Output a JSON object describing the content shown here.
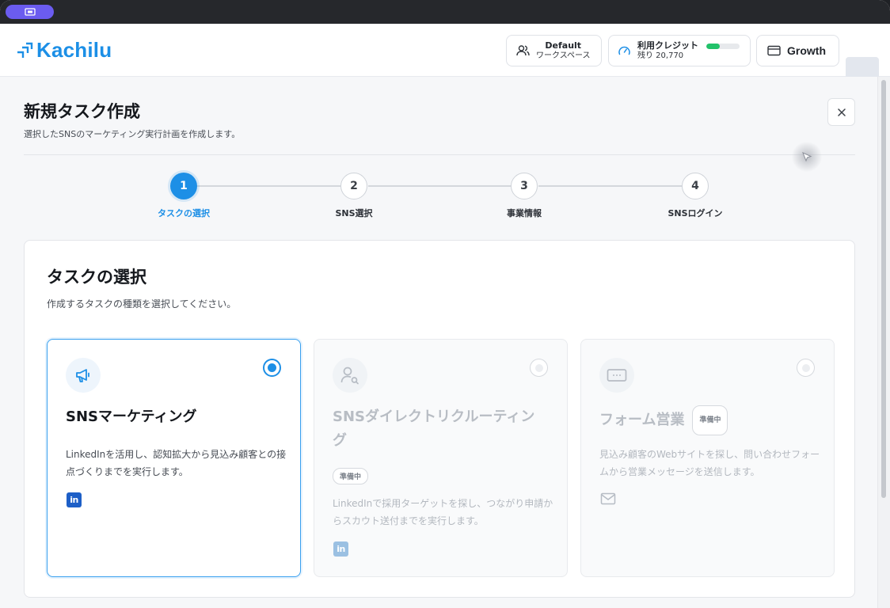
{
  "titlebar": {
    "pill_icon": "screen-share-icon",
    "pill_color": "#6b5cf0"
  },
  "header": {
    "logo_text": "Kachilu",
    "logo_icon": "kachilu-arrow-logo",
    "workspace": {
      "name": "Default",
      "label": "ワークスペース",
      "icon": "users-icon"
    },
    "credits": {
      "label": "利用クレジット",
      "remaining": "残り 20,770",
      "usage_fraction": 0.4,
      "icon": "gauge-icon",
      "bar_color": "#22c26a"
    },
    "plan": {
      "label": "Growth",
      "icon": "credit-card-icon"
    }
  },
  "page": {
    "title": "新規タスク作成",
    "subtitle": "選択したSNSのマーケティング実行計画を作成します。",
    "close_icon": "close-icon"
  },
  "stepper": {
    "active_step": 1,
    "steps": [
      {
        "number": "1",
        "label": "タスクの選択"
      },
      {
        "number": "2",
        "label": "SNS選択"
      },
      {
        "number": "3",
        "label": "事業情報"
      },
      {
        "number": "4",
        "label": "SNSログイン"
      }
    ]
  },
  "task_panel": {
    "title": "タスクの選択",
    "subtitle": "作成するタスクの種類を選択してください。",
    "cards": [
      {
        "title": "SNSマーケティング",
        "description": "LinkedInを活用し、認知拡大から見込み顧客との接点づくりまでを実行します。",
        "icon": "megaphone-icon",
        "channel_icon": "linkedin-icon",
        "channel_glyph": "in",
        "selected": true,
        "badge": ""
      },
      {
        "title": "SNSダイレクトリクルーティング",
        "description": "LinkedInで採用ターゲットを探し、つながり申請からスカウト送付までを実行します。",
        "icon": "user-search-icon",
        "channel_icon": "linkedin-icon",
        "channel_glyph": "in",
        "selected": false,
        "badge": "準備中"
      },
      {
        "title": "フォーム営業",
        "description": "見込み顧客のWebサイトを探し、問い合わせフォームから営業メッセージを送信します。",
        "icon": "form-input-icon",
        "channel_icon": "mail-icon",
        "selected": false,
        "badge": "準備中"
      }
    ]
  },
  "colors": {
    "accent": "#1d8fe6",
    "brand": "#1c8fe6"
  }
}
